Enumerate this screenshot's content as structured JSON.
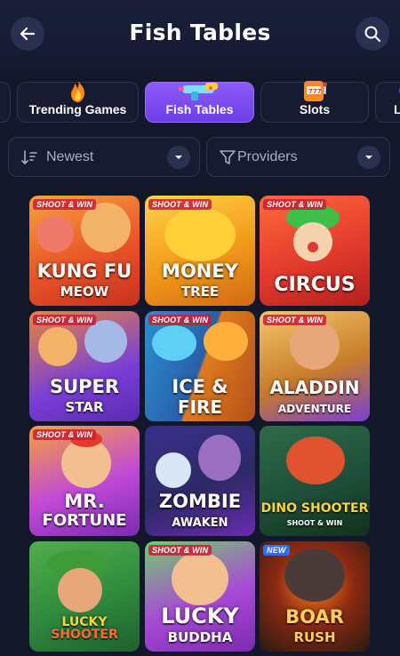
{
  "header": {
    "title": "Fish Tables",
    "back_icon": "arrow-left-icon",
    "search_icon": "search-icon"
  },
  "categories": [
    {
      "label": "",
      "icon": "partial-tab"
    },
    {
      "label": "Trending Games",
      "icon": "flame-icon"
    },
    {
      "label": "Fish Tables",
      "icon": "water-gun-icon",
      "active": true
    },
    {
      "label": "Slots",
      "icon": "slot-machine-icon"
    },
    {
      "label": "L",
      "icon": "partial-tab"
    }
  ],
  "filters": {
    "sort_label": "Newest",
    "sort_icon": "sort-descending-icon",
    "providers_label": "Providers",
    "providers_icon": "funnel-icon"
  },
  "games": [
    {
      "tag": "SHOOT & WIN",
      "line1": "KUNG FU",
      "line2": "MEOW",
      "bg": "#e8552a"
    },
    {
      "tag": "SHOOT & WIN",
      "line1": "MONEY",
      "line2": "TREE",
      "bg": "#f29a1a"
    },
    {
      "tag": "SHOOT & WIN",
      "line1": "CIRCUS",
      "line2": "",
      "bg": "#e23b2e"
    },
    {
      "tag": "SHOOT & WIN",
      "line1": "SUPER",
      "line2": "STAR",
      "bg": "#6d3fd0"
    },
    {
      "tag": "SHOOT & WIN",
      "line1": "ICE &",
      "line2": "FIRE",
      "bg": "#2a6fa8"
    },
    {
      "tag": "SHOOT & WIN",
      "line1": "ALADDIN",
      "line2": "ADVENTURE",
      "bg": "#c77c2a"
    },
    {
      "tag": "SHOOT & WIN",
      "line1": "MR.",
      "line2": "FORTUNE",
      "bg": "#9c3fd6"
    },
    {
      "tag": "",
      "line1": "ZOMBIE",
      "line2": "AWAKEN",
      "bg": "#2d2a66"
    },
    {
      "tag": "",
      "line1": "DINO SHOOTER",
      "line2": "SHOOT & WIN",
      "bg": "#1f4f3a"
    },
    {
      "tag": "",
      "line1": "LUCKY",
      "line2": "SHOOTER",
      "bg": "#2f8a3e"
    },
    {
      "tag": "SHOOT & WIN",
      "line1": "LUCKY",
      "line2": "BUDDHA",
      "bg": "#8a2fd0"
    },
    {
      "tag": "NEW",
      "line1": "BOAR",
      "line2": "RUSH",
      "bg": "#2a1a12"
    }
  ]
}
